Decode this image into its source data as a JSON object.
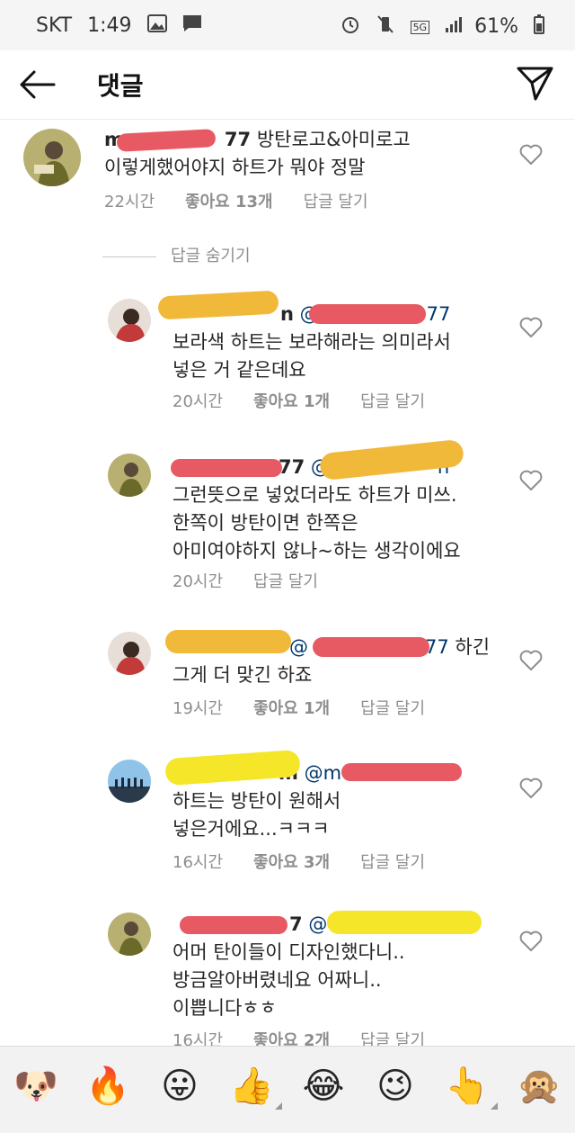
{
  "status_bar": {
    "carrier": "SKT",
    "time": "1:49",
    "network": "5G",
    "battery": "61%"
  },
  "header": {
    "title": "댓글"
  },
  "main_comment": {
    "username": "m",
    "username_tail": "77",
    "line1": "방탄로고&아미로고",
    "line2": "이렇게했어야지 하트가 뭐야 정말",
    "time": "22시간",
    "likes": "좋아요 13개",
    "reply": "답글 달기"
  },
  "hide_replies": "답글 숨기기",
  "replies": [
    {
      "username_tail": "n",
      "mention_tail": "77",
      "line1": "보라색 하트는 보라해라는 의미라서",
      "line2": "넣은 거 같은데요",
      "line3": "",
      "time": "20시간",
      "likes": "좋아요 1개",
      "reply": "답글 달기"
    },
    {
      "username_tail": "77",
      "mention_tail": "n",
      "line1": "그런뜻으로 넣었더라도 하트가 미쓰.",
      "line2": "한쪽이 방탄이면 한쪽은",
      "line3": "아미여야하지 않나~하는 생각이에요",
      "time": "20시간",
      "likes": "",
      "reply": "답글 달기"
    },
    {
      "username_tail": "",
      "mention_tail": "77",
      "after": "하긴",
      "line1": "그게 더 맞긴 하죠",
      "line2": "",
      "line3": "",
      "time": "19시간",
      "likes": "좋아요 1개",
      "reply": "답글 달기"
    },
    {
      "username_tail": "m",
      "mention_tail": "",
      "line1": "하트는 방탄이 원해서",
      "line2": "넣은거에요...ㅋㅋㅋ",
      "line3": "",
      "time": "16시간",
      "likes": "좋아요 3개",
      "reply": "답글 달기"
    },
    {
      "username_tail": "7",
      "mention_tail": "",
      "line1": "어머 탄이들이 디자인했다니..",
      "line2": "방금알아버렸네요 어짜니..",
      "line3": "이쁩니다ㅎㅎ",
      "time": "16시간",
      "likes": "좋아요 2개",
      "reply": "답글 달기"
    }
  ],
  "emoji_bar": [
    "🐶",
    "🔥",
    "😛",
    "👍",
    "😂",
    "😉",
    "👆",
    "🙊"
  ]
}
